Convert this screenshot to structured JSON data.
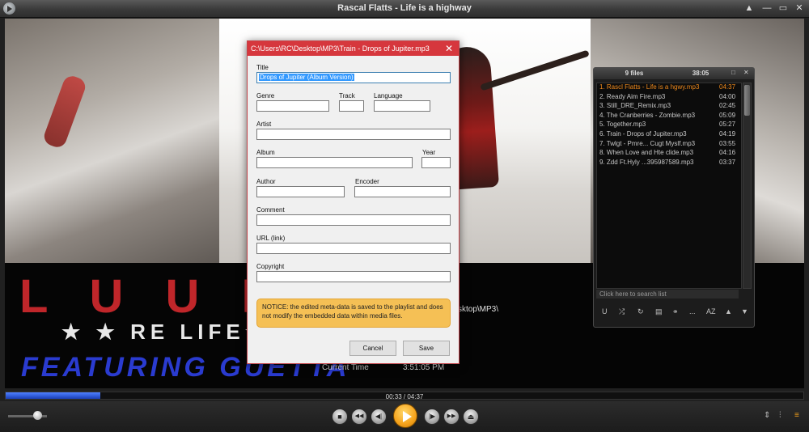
{
  "window": {
    "title": "Rascal Flatts - Life is a highway",
    "btn_up": "▲",
    "btn_min": "—",
    "btn_max": "▭",
    "btn_close": "✕"
  },
  "video": {
    "letters": "L U U  RIS",
    "stars_text": "★ ★  RE       LIFE★ ★",
    "blue_text": "FEATURING     GUETTA",
    "path_fragment": "sktop\\MP3\\",
    "current_time_label": "Current Time",
    "current_time_value": "3:51:05 PM"
  },
  "dialog": {
    "title": "C:\\Users\\RC\\Desktop\\MP3\\Train - Drops of Jupiter.mp3",
    "close": "✕",
    "labels": {
      "title": "Title",
      "genre": "Genre",
      "track": "Track",
      "language": "Language",
      "artist": "Artist",
      "album": "Album",
      "year": "Year",
      "author": "Author",
      "encoder": "Encoder",
      "comment": "Comment",
      "url": "URL (link)",
      "copyright": "Copyright"
    },
    "values": {
      "title": "Drops of Jupiter (Album Version)",
      "genre": "",
      "track": "",
      "language": "",
      "artist": "",
      "album": "",
      "year": "",
      "author": "",
      "encoder": "",
      "comment": "",
      "url": "",
      "copyright": ""
    },
    "notice": "NOTICE: the edited meta-data is saved to the playlist and does not modify the embedded data within media files.",
    "cancel": "Cancel",
    "save": "Save"
  },
  "playlist": {
    "count": "9 files",
    "duration": "38:05",
    "btn_restore": "□",
    "btn_close": "✕",
    "search_placeholder": "Click here to search list",
    "items": [
      {
        "name": "1. Rascl Flatts - Life is a hgwy.mp3",
        "dur": "04:37"
      },
      {
        "name": "2. Ready Aim Fire.mp3",
        "dur": "04:00"
      },
      {
        "name": "3. Still_DRE_Remix.mp3",
        "dur": "02:45"
      },
      {
        "name": "4. The Cranberries - Zombie.mp3",
        "dur": "05:09"
      },
      {
        "name": "5. Together.mp3",
        "dur": "05:27"
      },
      {
        "name": "6. Train - Drops of Jupiter.mp3",
        "dur": "04:19"
      },
      {
        "name": "7. Twlgt - Pmre... Cugt Myslf.mp3",
        "dur": "03:55"
      },
      {
        "name": "8. When Love and Hte clide.mp3",
        "dur": "04:16"
      },
      {
        "name": "9. Zdd Ft.Hyly ...395987589.mp3",
        "dur": "03:37"
      }
    ],
    "tools": {
      "shuffle_u": "U",
      "shuffle": "⤮",
      "repeat": "↻",
      "doc": "▤",
      "link": "⚭",
      "more": "...",
      "sort": "AZ",
      "up": "▲",
      "down": "▼"
    }
  },
  "player": {
    "time": "00:33 / 04:37",
    "progress": 0.119,
    "volume": 0.75,
    "btn_stop": "■",
    "btn_rewind": "◀◀",
    "btn_prev": "◀|",
    "btn_next": "|▶",
    "btn_forward": "▶▶",
    "btn_eject": "⏏",
    "tool_updown": "⇕",
    "tool_eq": "⫶",
    "tool_menu": "≡",
    "accent": "#f5a21b"
  }
}
